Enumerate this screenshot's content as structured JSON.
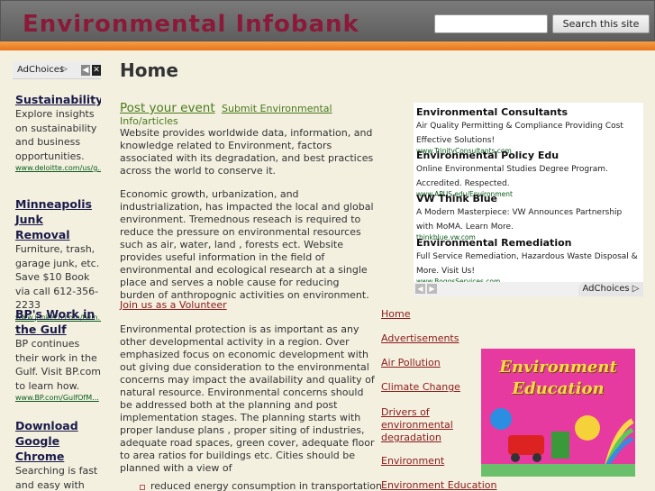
{
  "header": {
    "site_title": "Environmental Infobank",
    "search_placeholder": "",
    "search_button": "Search this site"
  },
  "left_ads": {
    "adchoices": "AdChoices",
    "items": [
      {
        "title": "Sustainability",
        "body": "Explore insights on sustainability and business opportunities.",
        "url": "www.deloitte.com/us/g..."
      },
      {
        "title": "Minneapolis Junk Removal",
        "body": "Furniture, trash, garage junk, etc. Save $10 Book via call 612-356-2233",
        "url": "www.junkeco.com/twin..."
      },
      {
        "title": "BP's Work in the Gulf",
        "body": "BP continues their work in the Gulf. Visit BP.com to learn how.",
        "url": "www.BP.com/GulfOfM..."
      },
      {
        "title": "Download Google Chrome",
        "body": "Searching is fast and easy with Google's web",
        "url": ""
      }
    ]
  },
  "main": {
    "heading": "Home",
    "post_event": "Post your event",
    "submit_info_1": "Submit Environmental",
    "submit_info_2": "Info/articles",
    "para1": "Website provides worldwide data, information, and knowledge related to Environment, factors associated with its degradation, and best practices across the world to conserve it.",
    "para2": "Economic growth, urbanization, and industrialization,  has impacted the local and global environment. Tremednous reseach is required to reduce the pressure on environmental resources such as air, water, land , forests ect. Website provides useful information in the field of environmental and ecological research at a single place and serves a noble cause for reducing burden of anthropognic activities on environment.",
    "volunteer": "Join us as a Volunteer",
    "para3": "Environmental protection is as important as any other developmental activity in a region. Over emphasized focus on economic development with out giving due consideration to the environmental concerns may impact the availability and quality of natural resource. Environmental concerns should be addressed both at the planning and post implementation stages. The planning starts with proper landuse plans , proper siting of industries, adequate road spaces, green cover, adequate floor to area ratios for buildings etc. Cities should be planned with a view of",
    "list_item_1": "reduced energy consumption in transportation"
  },
  "right_ads": {
    "adchoices": "AdChoices",
    "items": [
      {
        "title": "Environmental Consultants",
        "body": "Air Quality Permitting & Compliance Providing Cost Effective Solutions!",
        "url": "www.TrinityConsultants.com"
      },
      {
        "title": "Environmental Policy Edu",
        "body": "Online Environmental Studies Degree Program. Accredited. Respected.",
        "url": "www.APUS.edu/Environment"
      },
      {
        "title": "VW Think Blue",
        "body": "A Modern Masterpiece: VW Announces Partnership with MoMA. Learn More.",
        "url": "thinkblue.vw.com"
      },
      {
        "title": "Environmental Remediation",
        "body": "Full Service Remediation, Hazardous Waste Disposal & More. Visit Us!",
        "url": "www.BoggsServices.com"
      }
    ]
  },
  "nav": [
    "Home",
    "Advertisements",
    "Air Pollution",
    "Climate Change",
    "Drivers of environmental degradation",
    "Environment",
    "Environment Education"
  ],
  "env_image": {
    "line1": "Environment",
    "line2": "Education"
  },
  "colors": {
    "title": "#8b1a3a",
    "link_green": "#4a7a1a",
    "nav_link": "#8b1a1a",
    "orange": "#e8741a",
    "bg": "#f3f0e0"
  }
}
